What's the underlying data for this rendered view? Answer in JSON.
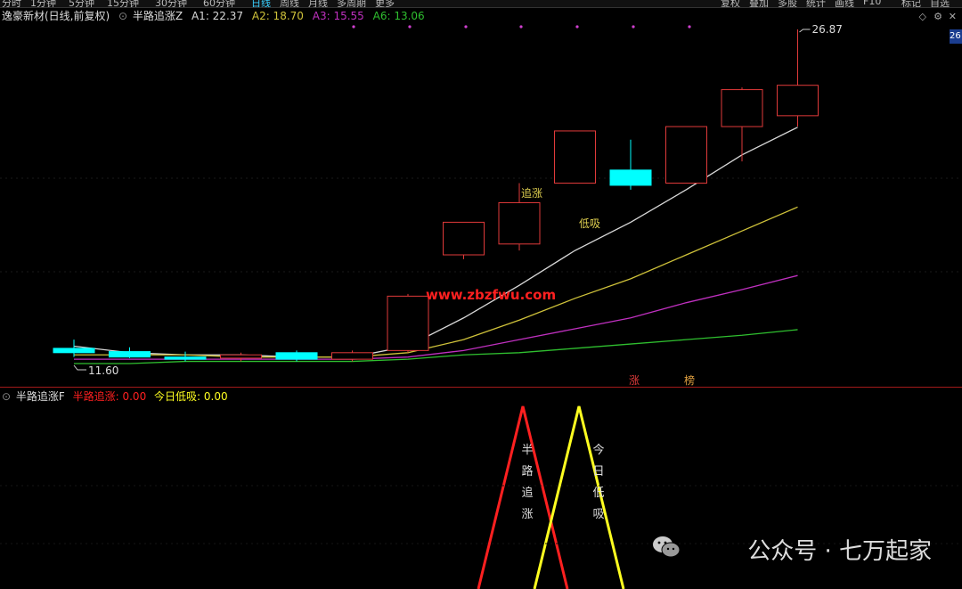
{
  "topbar": {
    "periods": [
      "分时",
      "1分钟",
      "5分钟",
      "15分钟",
      "30分钟",
      "60分钟",
      "日线",
      "周线",
      "月线",
      "多周期",
      "更多"
    ],
    "right_buttons": [
      "复权",
      "叠加",
      "多股",
      "统计",
      "画线",
      "F10",
      "标记",
      "自选"
    ]
  },
  "header": {
    "stock_name": "逸豪新材(日线,前复权)",
    "indicator": "半路追涨Z",
    "a1": "A1: 22.37",
    "a2": "A2: 18.70",
    "a3": "A3: 15.55",
    "a6": "A6: 13.06",
    "price_tag": "26"
  },
  "annotations": {
    "high": "26.87",
    "low": "11.60",
    "chase": "追涨",
    "dip_buy": "低吸",
    "limit_up": "涨",
    "board": "榜",
    "site_watermark": "www.zbzfwu.com"
  },
  "lower": {
    "indicator": "半路追涨F",
    "signal1_label": "半路追涨: 0.00",
    "signal2_label": "今日低吸: 0.00",
    "vlabel1": "半路追涨",
    "vlabel2": "今日低吸"
  },
  "watermark": {
    "text": "公众号 · 七万起家"
  },
  "colors": {
    "up": "#e03a3a",
    "down": "#00ffff",
    "a1": "#d8d8d8",
    "a2": "#cfc23a",
    "a3": "#c030c0",
    "a6": "#2fbf2f",
    "signal1": "#ff2020",
    "signal2": "#ffff20"
  },
  "chart_data": {
    "type": "candlestick",
    "ylim": [
      10.5,
      28.5
    ],
    "candles": [
      {
        "x": 1,
        "open": 12.2,
        "high": 12.6,
        "low": 11.8,
        "close": 12.0
      },
      {
        "x": 2,
        "open": 12.05,
        "high": 12.25,
        "low": 11.75,
        "close": 11.8
      },
      {
        "x": 3,
        "open": 11.8,
        "high": 12.05,
        "low": 11.6,
        "close": 11.7
      },
      {
        "x": 4,
        "open": 11.75,
        "high": 12.0,
        "low": 11.6,
        "close": 11.9
      },
      {
        "x": 5,
        "open": 12.0,
        "high": 12.1,
        "low": 11.6,
        "close": 11.7
      },
      {
        "x": 6,
        "open": 11.7,
        "high": 12.1,
        "low": 11.6,
        "close": 12.0
      },
      {
        "x": 7,
        "open": 12.1,
        "high": 14.7,
        "low": 12.0,
        "close": 14.6
      },
      {
        "x": 8,
        "open": 16.5,
        "high": 18.0,
        "low": 16.3,
        "close": 18.0
      },
      {
        "x": 9,
        "open": 17.0,
        "high": 19.8,
        "low": 16.7,
        "close": 18.9
      },
      {
        "x": 10,
        "open": 19.8,
        "high": 22.2,
        "low": 19.8,
        "close": 22.2
      },
      {
        "x": 11,
        "open": 20.4,
        "high": 21.8,
        "low": 19.5,
        "close": 19.7
      },
      {
        "x": 12,
        "open": 19.8,
        "high": 22.4,
        "low": 19.8,
        "close": 22.4
      },
      {
        "x": 13,
        "open": 22.4,
        "high": 24.2,
        "low": 20.8,
        "close": 24.1
      },
      {
        "x": 14,
        "open": 22.9,
        "high": 26.87,
        "low": 22.4,
        "close": 24.3
      }
    ],
    "series": [
      {
        "name": "A1",
        "values": [
          12.3,
          12.0,
          11.9,
          11.9,
          11.8,
          11.8,
          12.3,
          13.6,
          15.1,
          16.7,
          18.0,
          19.5,
          21.1,
          22.37
        ]
      },
      {
        "name": "A2",
        "values": [
          11.9,
          11.9,
          11.9,
          11.8,
          11.8,
          11.8,
          12.0,
          12.6,
          13.5,
          14.5,
          15.4,
          16.5,
          17.6,
          18.7
        ]
      },
      {
        "name": "A3",
        "values": [
          11.7,
          11.7,
          11.7,
          11.7,
          11.7,
          11.7,
          11.8,
          12.1,
          12.6,
          13.1,
          13.6,
          14.3,
          14.9,
          15.55
        ]
      },
      {
        "name": "A6",
        "values": [
          11.5,
          11.5,
          11.6,
          11.6,
          11.6,
          11.6,
          11.7,
          11.9,
          12.0,
          12.2,
          12.4,
          12.6,
          12.8,
          13.06
        ]
      }
    ],
    "signals": [
      {
        "name": "半路追涨",
        "peak_x": 9.3
      },
      {
        "name": "今日低吸",
        "peak_x": 10.3
      }
    ]
  }
}
